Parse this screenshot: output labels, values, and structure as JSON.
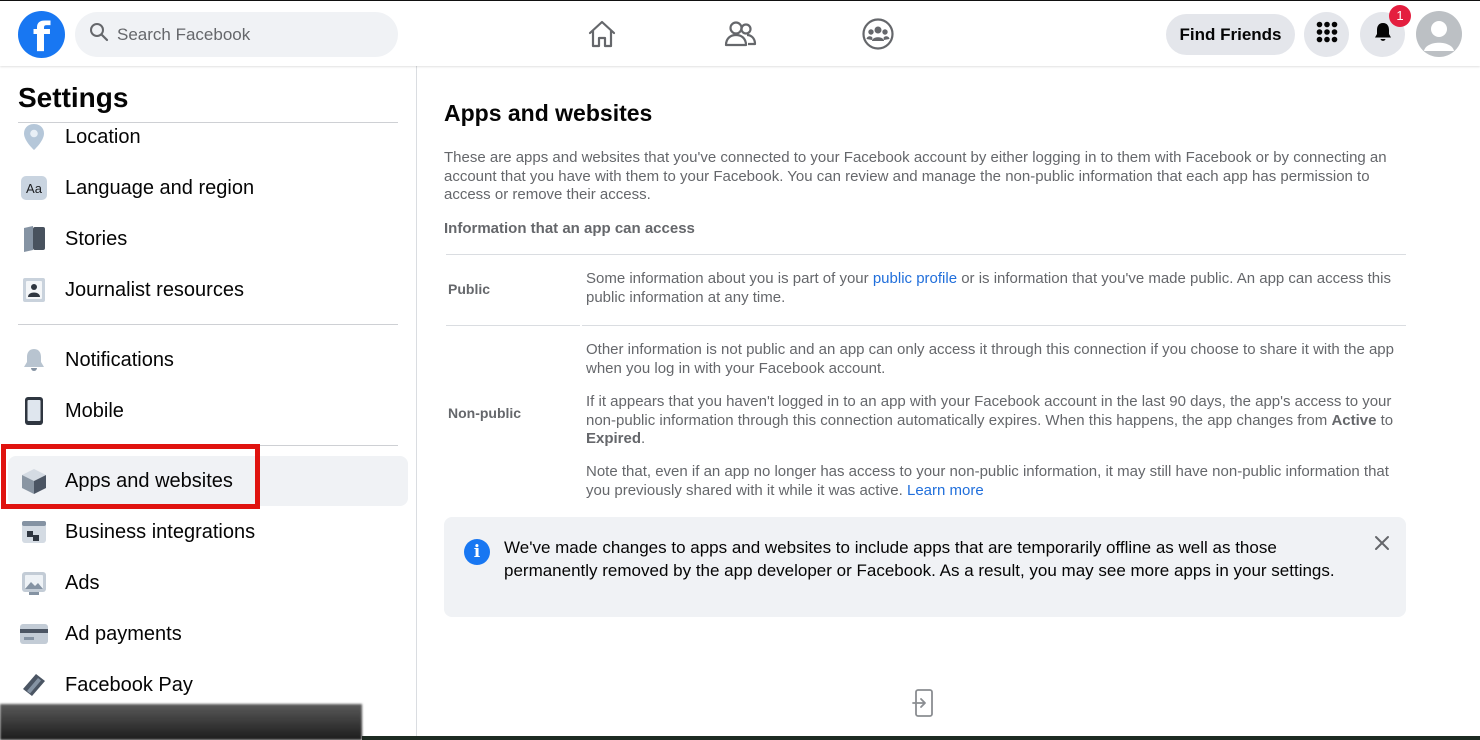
{
  "header": {
    "logo_letter": "f",
    "search_placeholder": "Search Facebook",
    "find_friends_label": "Find Friends",
    "notification_count": "1",
    "nav_icons": [
      "home-icon",
      "friends-icon",
      "groups-icon"
    ],
    "brand_color": "#1877f2"
  },
  "sidebar": {
    "title": "Settings",
    "items": [
      {
        "label": "Location",
        "icon": "location-pin-icon"
      },
      {
        "label": "Language and region",
        "icon": "language-icon"
      },
      {
        "label": "Stories",
        "icon": "stories-icon"
      },
      {
        "label": "Journalist resources",
        "icon": "journalist-icon"
      },
      {
        "label": "Notifications",
        "icon": "bell-icon"
      },
      {
        "label": "Mobile",
        "icon": "mobile-icon"
      },
      {
        "label": "Apps and websites",
        "icon": "apps-cube-icon",
        "active": true
      },
      {
        "label": "Business integrations",
        "icon": "business-integrations-icon"
      },
      {
        "label": "Ads",
        "icon": "ads-icon"
      },
      {
        "label": "Ad payments",
        "icon": "credit-card-icon"
      },
      {
        "label": "Facebook Pay",
        "icon": "facebook-pay-icon"
      }
    ]
  },
  "main": {
    "title": "Apps and websites",
    "intro": "These are apps and websites that you've connected to your Facebook account by either logging in to them with Facebook or by connecting an account that you have with them to your Facebook. You can review and manage the non-public information that each app has permission to access or remove their access.",
    "info_heading": "Information that an app can access",
    "public": {
      "label": "Public",
      "text_before": "Some information about you is part of your ",
      "link": "public profile",
      "text_after": " or is information that you've made public. An app can access this public information at any time."
    },
    "non_public": {
      "label": "Non-public",
      "p1": "Other information is not public and an app can only access it through this connection if you choose to share it with the app when you log in with your Facebook account.",
      "p2_before": "If it appears that you haven't logged in to an app with your Facebook account in the last 90 days, the app's access to your non-public information through this connection automatically expires. When this happens, the app changes from ",
      "p2_active": "Active",
      "p2_to": " to ",
      "p2_expired": "Expired",
      "p2_end": ".",
      "p3": "Note that, even if an app no longer has access to your non-public information, it may still have non-public information that you previously shared with it while it was active. ",
      "p3_link": "Learn more"
    },
    "notice": "We've made changes to apps and websites to include apps that are temporarily offline as well as those permanently removed by the app developer or Facebook. As a result, you may see more apps in your settings.",
    "link_color": "#216fdb",
    "highlight_color": "#e0130f"
  }
}
